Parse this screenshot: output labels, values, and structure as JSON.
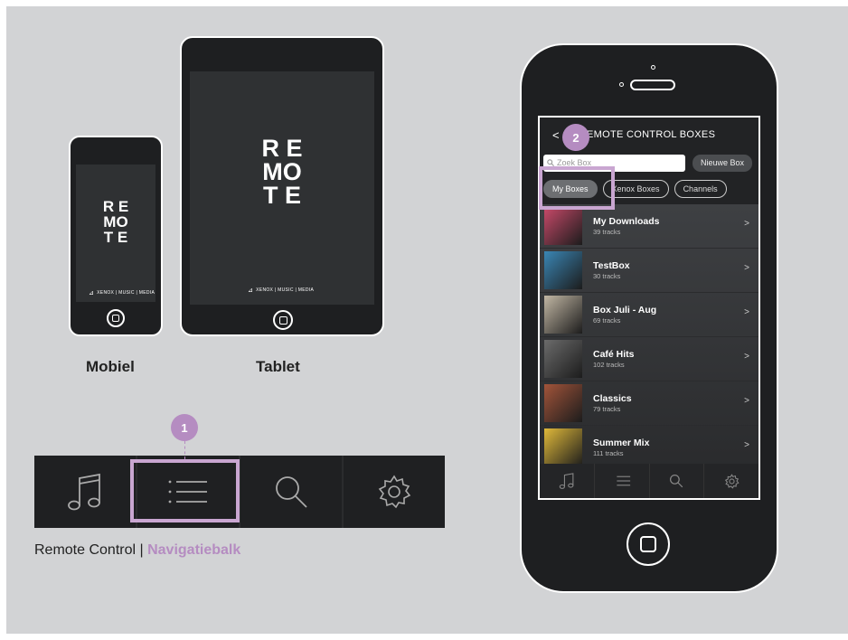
{
  "devices": {
    "logo_lines": [
      "R E",
      "MO",
      "T E"
    ],
    "brand_text": "XENOX | MUSIC | MEDIA",
    "mobile_label": "Mobiel",
    "tablet_label": "Tablet"
  },
  "navbar": {
    "badge": "1",
    "items": [
      {
        "icon": "music-note-icon"
      },
      {
        "icon": "list-icon"
      },
      {
        "icon": "search-icon"
      },
      {
        "icon": "gear-icon"
      }
    ],
    "highlight_color": "#c9a6d1"
  },
  "caption": {
    "prefix": "Remote Control | ",
    "highlight": "Navigatiebalk"
  },
  "app": {
    "badge": "2",
    "back_icon": "<",
    "title": "EMOTE CONTROL BOXES",
    "search_placeholder": "Zoek Box",
    "new_box_label": "Nieuwe Box",
    "chips": [
      "My Boxes",
      "Xenox Boxes",
      "Channels"
    ],
    "rows": [
      {
        "title": "My Downloads",
        "sub": "39 tracks",
        "color": "#c94a6a"
      },
      {
        "title": "TestBox",
        "sub": "30 tracks",
        "color": "#3a86b5"
      },
      {
        "title": "Box Juli - Aug",
        "sub": "69 tracks",
        "color": "#c2b7a4"
      },
      {
        "title": "Café Hits",
        "sub": "102 tracks",
        "color": "#6b6b6b"
      },
      {
        "title": "Classics",
        "sub": "79 tracks",
        "color": "#a2543a"
      },
      {
        "title": "Summer Mix",
        "sub": "111 tracks",
        "color": "#e0b93a"
      }
    ],
    "chevron": ">"
  },
  "colors": {
    "accent": "#b58cc1",
    "background": "#d2d3d5"
  }
}
